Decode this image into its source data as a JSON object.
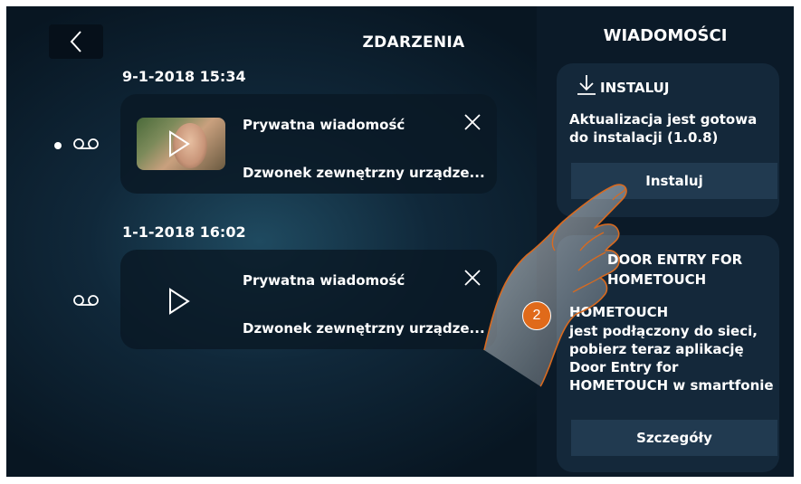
{
  "events": {
    "title": "ZDARZENIA",
    "items": [
      {
        "datetime": "9-1-2018  15:34",
        "title": "Prywatna wiadomość",
        "subtitle": "Dzwonek zewnętrzny urządze...",
        "unread": true,
        "has_thumbnail": true
      },
      {
        "datetime": "1-1-2018  16:02",
        "title": "Prywatna wiadomość",
        "subtitle": "Dzwonek zewnętrzny urządze...",
        "unread": false,
        "has_thumbnail": false
      }
    ]
  },
  "messages": {
    "title": "WIADOMOŚCI",
    "install_card": {
      "heading": "INSTALUJ",
      "body": "Aktualizacja jest gotowa do instalacji (1.0.8)",
      "button": "Instaluj"
    },
    "app_card": {
      "heading_line1": "DOOR ENTRY FOR",
      "heading_line2": "HOMETOUCH",
      "body_title": "HOMETOUCH",
      "body": "jest podłączony do sieci, pobierz teraz aplikację Door Entry for HOMETOUCH w smartfonie",
      "button": "Szczegóły"
    }
  },
  "overlay": {
    "step_badge": "2",
    "badge_color": "#e06a1a"
  },
  "icons": {
    "back": "back-chevron-icon",
    "voicemail": "voicemail-icon",
    "close": "close-icon",
    "play": "play-icon",
    "download": "download-icon"
  }
}
